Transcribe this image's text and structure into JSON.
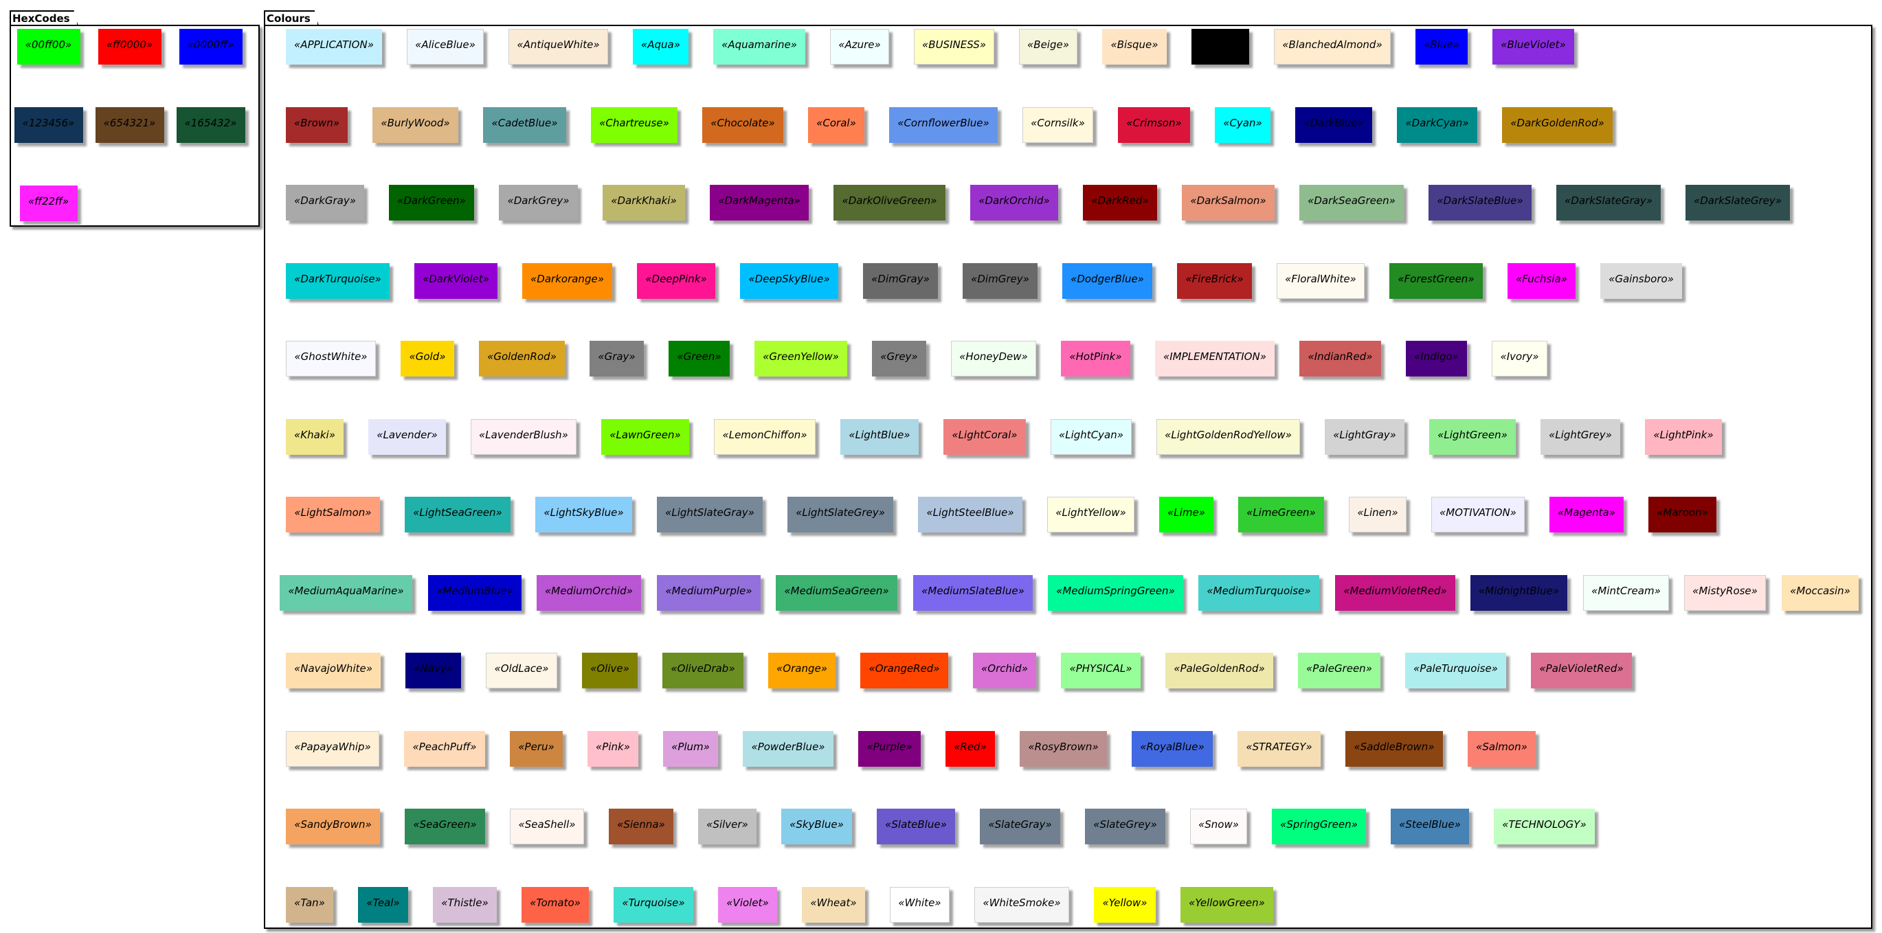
{
  "packages": {
    "hexcodes": "HexCodes",
    "colours": "Colours"
  },
  "hexcodes": [
    {
      "label": "«00ff00»",
      "color": "#00ff00"
    },
    {
      "label": "«ff0000»",
      "color": "#ff0000"
    },
    {
      "label": "«0000ff»",
      "color": "#0000ff"
    },
    {
      "label": "«123456»",
      "color": "#123456"
    },
    {
      "label": "«654321»",
      "color": "#654321"
    },
    {
      "label": "«165432»",
      "color": "#165432"
    },
    {
      "label": "«ff22ff»",
      "color": "#ff22ff"
    }
  ],
  "colours": [
    [
      {
        "label": "«APPLICATION»",
        "color": "#C2F0FF"
      },
      {
        "label": "«AliceBlue»",
        "color": "#F0F8FF"
      },
      {
        "label": "«AntiqueWhite»",
        "color": "#FAEBD7"
      },
      {
        "label": "«Aqua»",
        "color": "#00FFFF"
      },
      {
        "label": "«Aquamarine»",
        "color": "#7FFFD4"
      },
      {
        "label": "«Azure»",
        "color": "#F0FFFF"
      },
      {
        "label": "«BUSINESS»",
        "color": "#FFFFC2"
      },
      {
        "label": "«Beige»",
        "color": "#F5F5DC"
      },
      {
        "label": "«Bisque»",
        "color": "#FFE4C4"
      },
      {
        "label": "«Black»",
        "color": "#000000"
      },
      {
        "label": "«BlanchedAlmond»",
        "color": "#FFEBCD"
      },
      {
        "label": "«Blue»",
        "color": "#0000FF"
      },
      {
        "label": "«BlueViolet»",
        "color": "#8A2BE2"
      }
    ],
    [
      {
        "label": "«Brown»",
        "color": "#A52A2A"
      },
      {
        "label": "«BurlyWood»",
        "color": "#DEB887"
      },
      {
        "label": "«CadetBlue»",
        "color": "#5F9EA0"
      },
      {
        "label": "«Chartreuse»",
        "color": "#7FFF00"
      },
      {
        "label": "«Chocolate»",
        "color": "#D2691E"
      },
      {
        "label": "«Coral»",
        "color": "#FF7F50"
      },
      {
        "label": "«CornflowerBlue»",
        "color": "#6495ED"
      },
      {
        "label": "«Cornsilk»",
        "color": "#FFF8DC"
      },
      {
        "label": "«Crimson»",
        "color": "#DC143C"
      },
      {
        "label": "«Cyan»",
        "color": "#00FFFF"
      },
      {
        "label": "«DarkBlue»",
        "color": "#00008B"
      },
      {
        "label": "«DarkCyan»",
        "color": "#008B8B"
      },
      {
        "label": "«DarkGoldenRod»",
        "color": "#B8860B"
      }
    ],
    [
      {
        "label": "«DarkGray»",
        "color": "#A9A9A9"
      },
      {
        "label": "«DarkGreen»",
        "color": "#006400"
      },
      {
        "label": "«DarkGrey»",
        "color": "#A9A9A9"
      },
      {
        "label": "«DarkKhaki»",
        "color": "#BDB76B"
      },
      {
        "label": "«DarkMagenta»",
        "color": "#8B008B"
      },
      {
        "label": "«DarkOliveGreen»",
        "color": "#556B2F"
      },
      {
        "label": "«DarkOrchid»",
        "color": "#9932CC"
      },
      {
        "label": "«DarkRed»",
        "color": "#8B0000"
      },
      {
        "label": "«DarkSalmon»",
        "color": "#E9967A"
      },
      {
        "label": "«DarkSeaGreen»",
        "color": "#8FBC8F"
      },
      {
        "label": "«DarkSlateBlue»",
        "color": "#483D8B"
      },
      {
        "label": "«DarkSlateGray»",
        "color": "#2F4F4F"
      },
      {
        "label": "«DarkSlateGrey»",
        "color": "#2F4F4F"
      }
    ],
    [
      {
        "label": "«DarkTurquoise»",
        "color": "#00CED1"
      },
      {
        "label": "«DarkViolet»",
        "color": "#9400D3"
      },
      {
        "label": "«Darkorange»",
        "color": "#FF8C00"
      },
      {
        "label": "«DeepPink»",
        "color": "#FF1493"
      },
      {
        "label": "«DeepSkyBlue»",
        "color": "#00BFFF"
      },
      {
        "label": "«DimGray»",
        "color": "#696969"
      },
      {
        "label": "«DimGrey»",
        "color": "#696969"
      },
      {
        "label": "«DodgerBlue»",
        "color": "#1E90FF"
      },
      {
        "label": "«FireBrick»",
        "color": "#B22222"
      },
      {
        "label": "«FloralWhite»",
        "color": "#FFFAF0"
      },
      {
        "label": "«ForestGreen»",
        "color": "#228B22"
      },
      {
        "label": "«Fuchsia»",
        "color": "#FF00FF"
      },
      {
        "label": "«Gainsboro»",
        "color": "#DCDCDC"
      }
    ],
    [
      {
        "label": "«GhostWhite»",
        "color": "#F8F8FF"
      },
      {
        "label": "«Gold»",
        "color": "#FFD700"
      },
      {
        "label": "«GoldenRod»",
        "color": "#DAA520"
      },
      {
        "label": "«Gray»",
        "color": "#808080"
      },
      {
        "label": "«Green»",
        "color": "#008000"
      },
      {
        "label": "«GreenYellow»",
        "color": "#ADFF2F"
      },
      {
        "label": "«Grey»",
        "color": "#808080"
      },
      {
        "label": "«HoneyDew»",
        "color": "#F0FFF0"
      },
      {
        "label": "«HotPink»",
        "color": "#FF69B4"
      },
      {
        "label": "«IMPLEMENTATION»",
        "color": "#FFE0E0"
      },
      {
        "label": "«IndianRed»",
        "color": "#CD5C5C"
      },
      {
        "label": "«Indigo»",
        "color": "#4B0082"
      },
      {
        "label": "«Ivory»",
        "color": "#FFFFF0"
      }
    ],
    [
      {
        "label": "«Khaki»",
        "color": "#F0E68C"
      },
      {
        "label": "«Lavender»",
        "color": "#E6E6FA"
      },
      {
        "label": "«LavenderBlush»",
        "color": "#FFF0F5"
      },
      {
        "label": "«LawnGreen»",
        "color": "#7CFC00"
      },
      {
        "label": "«LemonChiffon»",
        "color": "#FFFACD"
      },
      {
        "label": "«LightBlue»",
        "color": "#ADD8E6"
      },
      {
        "label": "«LightCoral»",
        "color": "#F08080"
      },
      {
        "label": "«LightCyan»",
        "color": "#E0FFFF"
      },
      {
        "label": "«LightGoldenRodYellow»",
        "color": "#FAFAD2"
      },
      {
        "label": "«LightGray»",
        "color": "#D3D3D3"
      },
      {
        "label": "«LightGreen»",
        "color": "#90EE90"
      },
      {
        "label": "«LightGrey»",
        "color": "#D3D3D3"
      },
      {
        "label": "«LightPink»",
        "color": "#FFB6C1"
      }
    ],
    [
      {
        "label": "«LightSalmon»",
        "color": "#FFA07A"
      },
      {
        "label": "«LightSeaGreen»",
        "color": "#20B2AA"
      },
      {
        "label": "«LightSkyBlue»",
        "color": "#87CEFA"
      },
      {
        "label": "«LightSlateGray»",
        "color": "#778899"
      },
      {
        "label": "«LightSlateGrey»",
        "color": "#778899"
      },
      {
        "label": "«LightSteelBlue»",
        "color": "#B0C4DE"
      },
      {
        "label": "«LightYellow»",
        "color": "#FFFFE0"
      },
      {
        "label": "«Lime»",
        "color": "#00FF00"
      },
      {
        "label": "«LimeGreen»",
        "color": "#32CD32"
      },
      {
        "label": "«Linen»",
        "color": "#FAF0E6"
      },
      {
        "label": "«MOTIVATION»",
        "color": "#EFEFFF"
      },
      {
        "label": "«Magenta»",
        "color": "#FF00FF"
      },
      {
        "label": "«Maroon»",
        "color": "#800000"
      }
    ],
    [
      {
        "label": "«MediumAquaMarine»",
        "color": "#66CDAA"
      },
      {
        "label": "«MediumBlue»",
        "color": "#0000CD"
      },
      {
        "label": "«MediumOrchid»",
        "color": "#BA55D3"
      },
      {
        "label": "«MediumPurple»",
        "color": "#9370DB"
      },
      {
        "label": "«MediumSeaGreen»",
        "color": "#3CB371"
      },
      {
        "label": "«MediumSlateBlue»",
        "color": "#7B68EE"
      },
      {
        "label": "«MediumSpringGreen»",
        "color": "#00FA9A"
      },
      {
        "label": "«MediumTurquoise»",
        "color": "#48D1CC"
      },
      {
        "label": "«MediumVioletRed»",
        "color": "#C71585"
      },
      {
        "label": "«MidnightBlue»",
        "color": "#191970"
      },
      {
        "label": "«MintCream»",
        "color": "#F5FFFA"
      },
      {
        "label": "«MistyRose»",
        "color": "#FFE4E1"
      },
      {
        "label": "«Moccasin»",
        "color": "#FFE4B5"
      }
    ],
    [
      {
        "label": "«NavajoWhite»",
        "color": "#FFDEAD"
      },
      {
        "label": "«Navy»",
        "color": "#000080"
      },
      {
        "label": "«OldLace»",
        "color": "#FDF5E6"
      },
      {
        "label": "«Olive»",
        "color": "#808000"
      },
      {
        "label": "«OliveDrab»",
        "color": "#6B8E23"
      },
      {
        "label": "«Orange»",
        "color": "#FFA500"
      },
      {
        "label": "«OrangeRed»",
        "color": "#FF4500"
      },
      {
        "label": "«Orchid»",
        "color": "#DA70D6"
      },
      {
        "label": "«PHYSICAL»",
        "color": "#97FF97"
      },
      {
        "label": "«PaleGoldenRod»",
        "color": "#EEE8AA"
      },
      {
        "label": "«PaleGreen»",
        "color": "#98FB98"
      },
      {
        "label": "«PaleTurquoise»",
        "color": "#AFEEEE"
      },
      {
        "label": "«PaleVioletRed»",
        "color": "#DB7093"
      }
    ],
    [
      {
        "label": "«PapayaWhip»",
        "color": "#FFEFD5"
      },
      {
        "label": "«PeachPuff»",
        "color": "#FFDAB9"
      },
      {
        "label": "«Peru»",
        "color": "#CD853F"
      },
      {
        "label": "«Pink»",
        "color": "#FFC0CB"
      },
      {
        "label": "«Plum»",
        "color": "#DDA0DD"
      },
      {
        "label": "«PowderBlue»",
        "color": "#B0E0E6"
      },
      {
        "label": "«Purple»",
        "color": "#800080"
      },
      {
        "label": "«Red»",
        "color": "#FF0000"
      },
      {
        "label": "«RosyBrown»",
        "color": "#BC8F8F"
      },
      {
        "label": "«RoyalBlue»",
        "color": "#4169E1"
      },
      {
        "label": "«STRATEGY»",
        "color": "#F5DEB3"
      },
      {
        "label": "«SaddleBrown»",
        "color": "#8B4513"
      },
      {
        "label": "«Salmon»",
        "color": "#FA8072"
      }
    ],
    [
      {
        "label": "«SandyBrown»",
        "color": "#F4A460"
      },
      {
        "label": "«SeaGreen»",
        "color": "#2E8B57"
      },
      {
        "label": "«SeaShell»",
        "color": "#FFF5EE"
      },
      {
        "label": "«Sienna»",
        "color": "#A0522D"
      },
      {
        "label": "«Silver»",
        "color": "#C0C0C0"
      },
      {
        "label": "«SkyBlue»",
        "color": "#87CEEB"
      },
      {
        "label": "«SlateBlue»",
        "color": "#6A5ACD"
      },
      {
        "label": "«SlateGray»",
        "color": "#708090"
      },
      {
        "label": "«SlateGrey»",
        "color": "#708090"
      },
      {
        "label": "«Snow»",
        "color": "#FFFAFA"
      },
      {
        "label": "«SpringGreen»",
        "color": "#00FF7F"
      },
      {
        "label": "«SteelBlue»",
        "color": "#4682B4"
      },
      {
        "label": "«TECHNOLOGY»",
        "color": "#C2FFC2"
      }
    ],
    [
      {
        "label": "«Tan»",
        "color": "#D2B48C"
      },
      {
        "label": "«Teal»",
        "color": "#008080"
      },
      {
        "label": "«Thistle»",
        "color": "#D8BFD8"
      },
      {
        "label": "«Tomato»",
        "color": "#FF6347"
      },
      {
        "label": "«Turquoise»",
        "color": "#40E0D0"
      },
      {
        "label": "«Violet»",
        "color": "#EE82EE"
      },
      {
        "label": "«Wheat»",
        "color": "#F5DEB3"
      },
      {
        "label": "«White»",
        "color": "#FFFFFF"
      },
      {
        "label": "«WhiteSmoke»",
        "color": "#F5F5F5"
      },
      {
        "label": "«Yellow»",
        "color": "#FFFF00"
      },
      {
        "label": "«YellowGreen»",
        "color": "#9ACD32"
      }
    ]
  ]
}
